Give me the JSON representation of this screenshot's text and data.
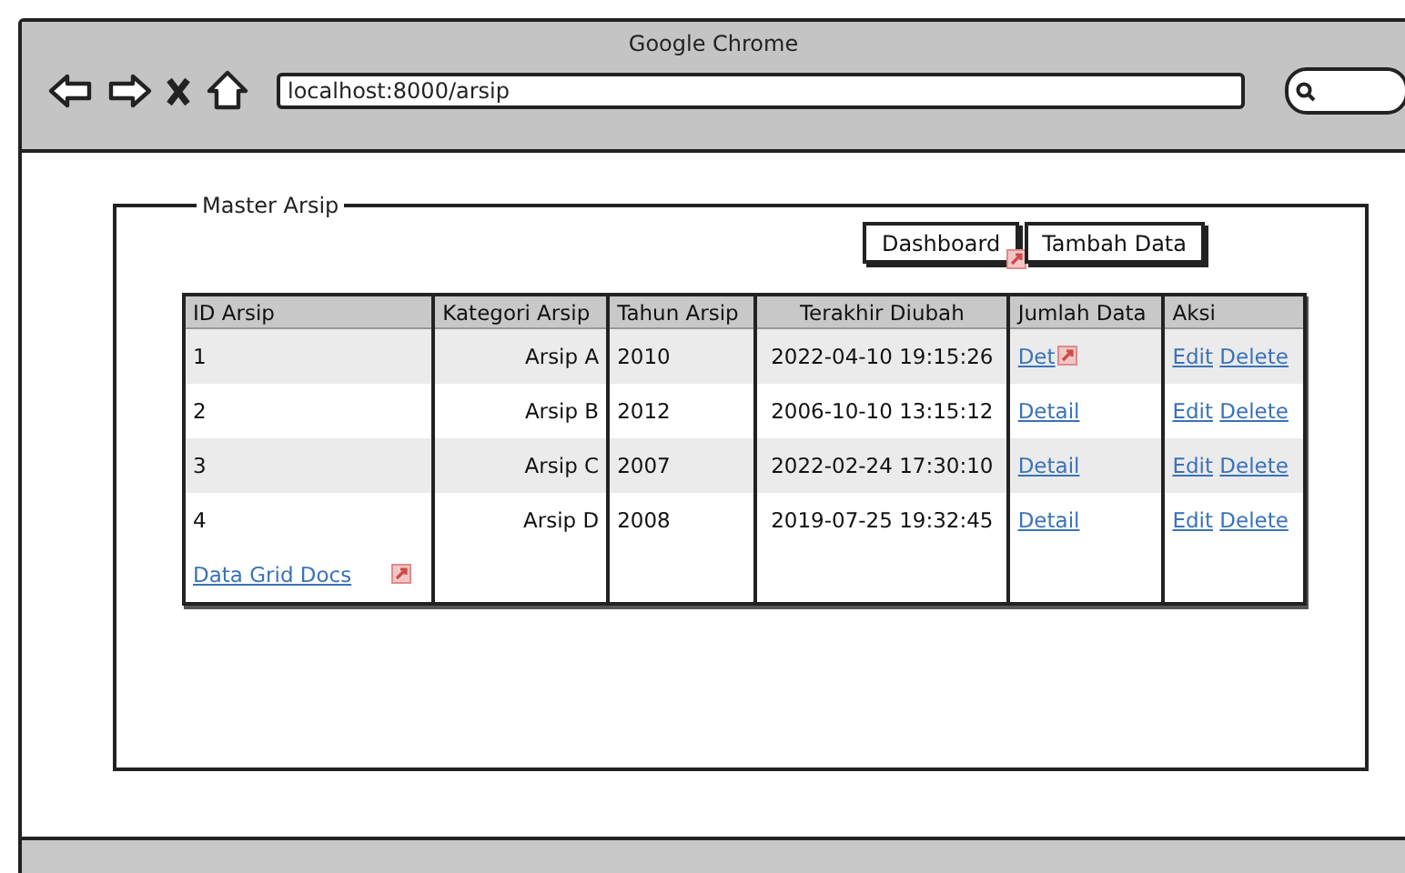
{
  "window": {
    "title": "Google Chrome"
  },
  "address_bar": {
    "value": "localhost:8000/arsip"
  },
  "panel": {
    "title": "Master Arsip",
    "buttons": [
      {
        "label": "Dashboard",
        "linked": true
      },
      {
        "label": "Tambah Data",
        "linked": false
      }
    ],
    "table": {
      "columns": [
        "ID Arsip",
        "Kategori Arsip",
        "Tahun Arsip",
        "Terakhir Diubah",
        "Jumlah Data",
        "Aksi"
      ],
      "rows": [
        {
          "id": "1",
          "kategori": "Arsip A",
          "tahun": "2010",
          "diubah": "2022-04-10 19:15:26",
          "detail": {
            "label": "Det",
            "linked": true
          },
          "actions": [
            "Edit",
            "Delete"
          ]
        },
        {
          "id": "2",
          "kategori": "Arsip B",
          "tahun": "2012",
          "diubah": "2006-10-10 13:15:12",
          "detail": {
            "label": "Detail",
            "linked": false
          },
          "actions": [
            "Edit",
            "Delete"
          ]
        },
        {
          "id": "3",
          "kategori": "Arsip C",
          "tahun": "2007",
          "diubah": "2022-02-24 17:30:10",
          "detail": {
            "label": "Detail",
            "linked": false
          },
          "actions": [
            "Edit",
            "Delete"
          ]
        },
        {
          "id": "4",
          "kategori": "Arsip D",
          "tahun": "2008",
          "diubah": "2019-07-25 19:32:45",
          "detail": {
            "label": "Detail",
            "linked": false
          },
          "actions": [
            "Edit",
            "Delete"
          ]
        }
      ],
      "footer_link": {
        "label": "Data Grid Docs",
        "linked": true
      }
    }
  }
}
